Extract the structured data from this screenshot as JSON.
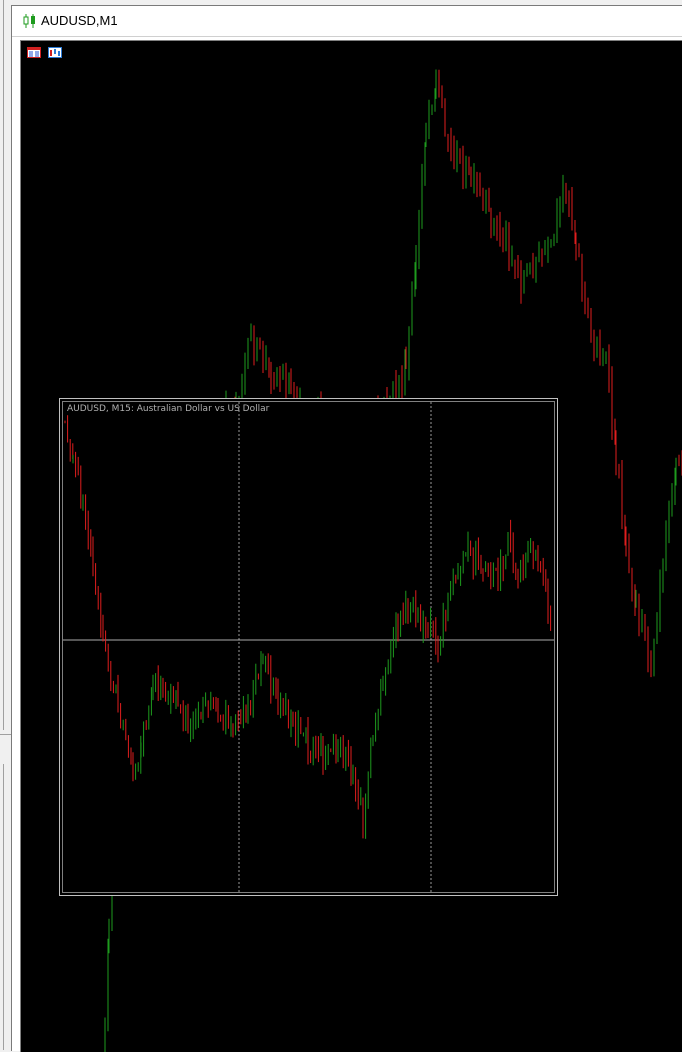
{
  "window": {
    "title": "AUDUSD,M1",
    "title_icon": "candlestick-chart-icon"
  },
  "toolbar_icons": [
    "data-window-icon",
    "chart-properties-icon"
  ],
  "main_chart": {
    "symbol": "AUDUSD",
    "timeframe": "M1",
    "background": "#000000",
    "bull_color": "#1e9b1e",
    "bear_color": "#e01e1e"
  },
  "popup_chart": {
    "title": "AUDUSD, M15:  Australian Dollar vs US Dollar",
    "background": "#000000",
    "grid_color": "#c0c0c0"
  }
}
